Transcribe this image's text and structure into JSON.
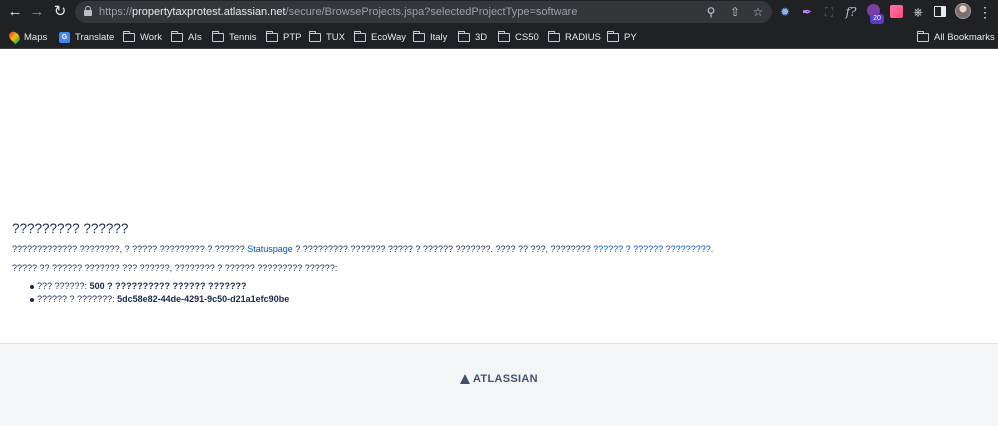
{
  "browser": {
    "url_scheme": "https://",
    "url_host": "propertytaxprotest.atlassian.net",
    "url_path": "/secure/BrowseProjects.jspa?selectedProjectType=software",
    "extension_badge": "20",
    "bookmarks": [
      {
        "label": "Maps",
        "icon": "maps-icon"
      },
      {
        "label": "Translate",
        "icon": "translate-icon"
      },
      {
        "label": "Work",
        "icon": "folder-icon"
      },
      {
        "label": "AIs",
        "icon": "folder-icon"
      },
      {
        "label": "Tennis",
        "icon": "folder-icon"
      },
      {
        "label": "PTP",
        "icon": "folder-icon"
      },
      {
        "label": "TUX",
        "icon": "folder-icon"
      },
      {
        "label": "EcoWay",
        "icon": "folder-icon"
      },
      {
        "label": "Italy",
        "icon": "folder-icon"
      },
      {
        "label": "3D",
        "icon": "folder-icon"
      },
      {
        "label": "CS50",
        "icon": "folder-icon"
      },
      {
        "label": "RADIUS",
        "icon": "folder-icon"
      },
      {
        "label": "PY",
        "icon": "folder-icon"
      }
    ],
    "all_bookmarks_label": "All Bookmarks"
  },
  "error": {
    "title": "????????? ??????",
    "para1_before": "????????????? ????????, ? ????? ????????? ? ?????? ",
    "para1_link": "Statuspage",
    "para1_middle": " ? ????????? ??????? ????? ? ?????? ???????. ???? ?? ???, ???????? ",
    "para1_link2": "?????? ? ?????? ?????????",
    "para1_end": ".",
    "para2": "????? ?? ?????? ??????? ??? ??????, ???????? ? ?????? ????????? ??????:",
    "items": [
      {
        "label": "??? ??????: ",
        "value": "500 ? ?????????? ?????? ???????"
      },
      {
        "label": "?????? ? ???????: ",
        "value": "5dc58e82-44de-4291-9c50-d21a1efc90be"
      }
    ]
  },
  "footer": {
    "brand": "ATLASSIAN"
  },
  "colors": {
    "chrome": "#202124",
    "text": "#172b4d",
    "link": "#0052cc",
    "footer_bg": "#f4f5f7"
  }
}
